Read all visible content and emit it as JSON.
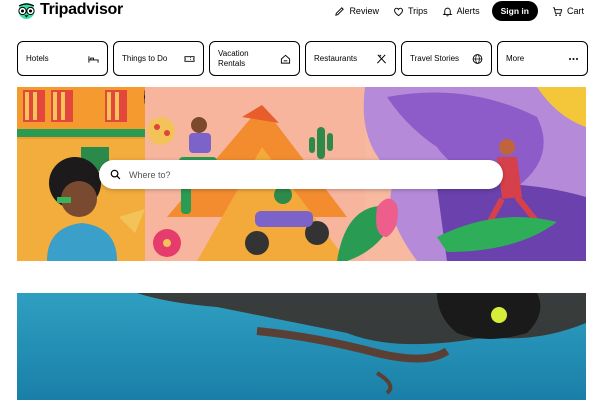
{
  "brand": {
    "name": "Tripadvisor"
  },
  "nav": {
    "review": "Review",
    "trips": "Trips",
    "alerts": "Alerts",
    "signin": "Sign in",
    "cart": "Cart"
  },
  "tabs": [
    {
      "label": "Hotels",
      "icon": "bed-icon"
    },
    {
      "label": "Things to Do",
      "icon": "ticket-icon"
    },
    {
      "label": "Vacation Rentals",
      "icon": "house-icon"
    },
    {
      "label": "Restaurants",
      "icon": "fork-knife-icon"
    },
    {
      "label": "Travel Stories",
      "icon": "globe-icon"
    },
    {
      "label": "More",
      "icon": "more-dots-icon"
    }
  ],
  "search": {
    "placeholder": "Where to?"
  },
  "colors": {
    "accent": "#000000",
    "logo_green": "#34e0a1"
  }
}
